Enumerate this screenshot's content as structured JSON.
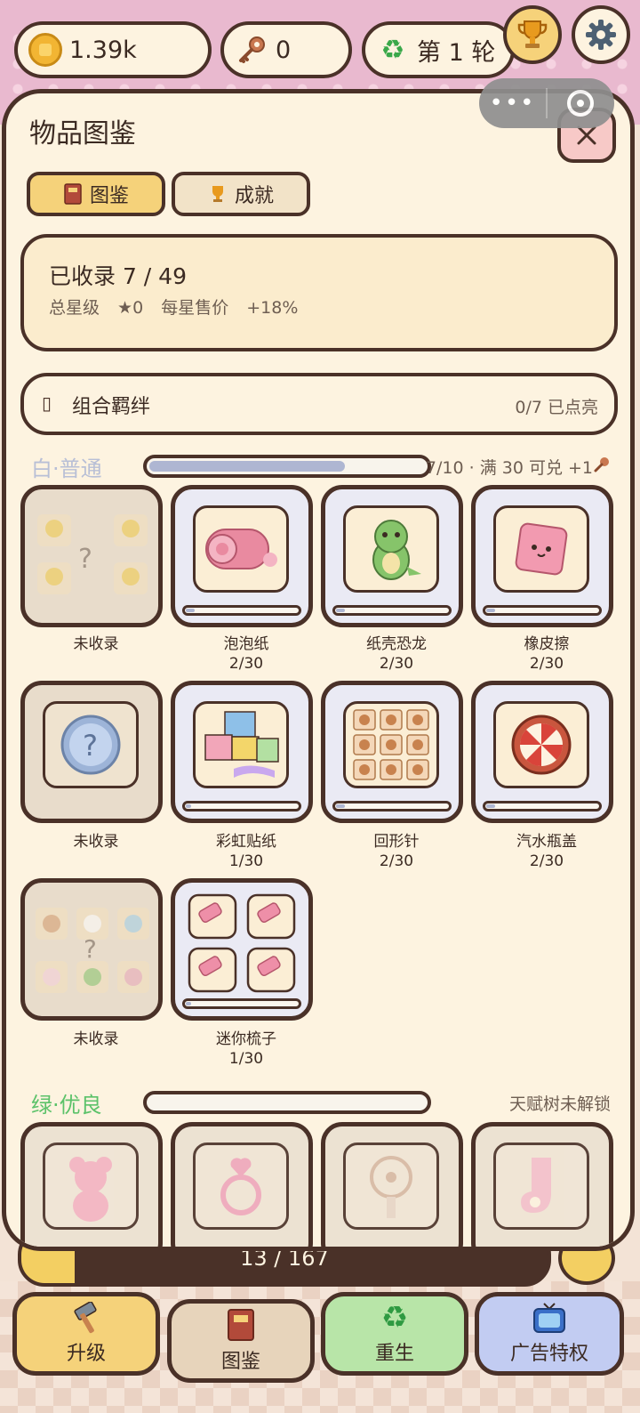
{
  "topbar": {
    "coins": "1.39k",
    "keys": "0",
    "round": "第 1 轮"
  },
  "panel": {
    "title": "物品图鉴",
    "tabs": [
      {
        "label": "图鉴",
        "active": true
      },
      {
        "label": "成就",
        "active": false
      }
    ],
    "summary": {
      "collected": "已收录 7 / 49",
      "stars": "总星级 ★0",
      "bonus": "每星售价 +18%"
    },
    "bonds": {
      "label": "组合羁绊",
      "count": "0/7 已点亮"
    },
    "tiers": [
      {
        "name": "白·普通",
        "color": "#b8bfd6",
        "progress": 0.7,
        "info": "7/10 · 满 30 可兑 +1",
        "items": [
          {
            "name": "未收录",
            "count": "",
            "collected": false,
            "icon": "duck-silhouette-icon"
          },
          {
            "name": "泡泡纸",
            "count": "2/30",
            "collected": true,
            "icon": "bubble-wrap-icon",
            "progress": 0.067
          },
          {
            "name": "纸壳恐龙",
            "count": "2/30",
            "collected": true,
            "icon": "dinosaur-icon",
            "progress": 0.067
          },
          {
            "name": "橡皮擦",
            "count": "2/30",
            "collected": true,
            "icon": "eraser-icon",
            "progress": 0.067
          },
          {
            "name": "未收录",
            "count": "",
            "collected": false,
            "icon": "marble-icon"
          },
          {
            "name": "彩虹贴纸",
            "count": "1/30",
            "collected": true,
            "icon": "sticker-pile-icon",
            "progress": 0.033
          },
          {
            "name": "回形针",
            "count": "2/30",
            "collected": true,
            "icon": "paperclip-grid-icon",
            "progress": 0.067
          },
          {
            "name": "汽水瓶盖",
            "count": "2/30",
            "collected": true,
            "icon": "bottle-cap-icon",
            "progress": 0.067
          },
          {
            "name": "未收录",
            "count": "",
            "collected": false,
            "icon": "animal-figures-icon"
          },
          {
            "name": "迷你梳子",
            "count": "1/30",
            "collected": true,
            "icon": "mini-comb-icon",
            "progress": 0.033
          }
        ]
      },
      {
        "name": "绿·优良",
        "color": "#5cc26a",
        "progress": 0,
        "info": "天赋树未解锁",
        "items": [
          {
            "icon": "gummy-bear-icon"
          },
          {
            "icon": "heart-ring-icon"
          },
          {
            "icon": "mini-fan-icon"
          },
          {
            "icon": "sock-icon"
          }
        ]
      }
    ]
  },
  "under_bar": {
    "text": "13 / 167"
  },
  "nav": [
    {
      "label": "升级",
      "icon": "hammer-icon"
    },
    {
      "label": "图鉴",
      "icon": "book-icon"
    },
    {
      "label": "重生",
      "icon": "recycle-icon"
    },
    {
      "label": "广告特权",
      "icon": "tv-icon"
    }
  ],
  "colors": {
    "outline": "#4a3128",
    "panel": "#fdf3e0",
    "accent_yellow": "#f5d27a",
    "rebirth_green": "#b8e5a8",
    "ad_blue": "#c2ccf2"
  }
}
